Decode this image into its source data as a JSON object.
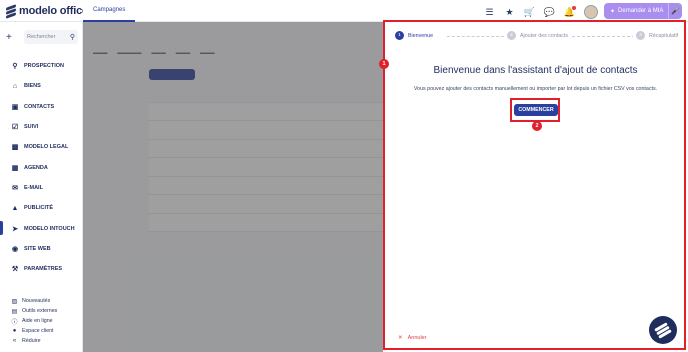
{
  "app": {
    "logo_text": "modelo office",
    "active_tab": "Campagnes"
  },
  "header": {
    "icons": [
      "layers-icon",
      "star-icon",
      "cart-icon",
      "chat-icon",
      "bell-icon"
    ],
    "mia_label": "Demander à MIA"
  },
  "sidebar": {
    "search_placeholder": "Rechercher",
    "items": [
      {
        "label": "PROSPECTION",
        "icon": "search-icon"
      },
      {
        "label": "BIENS",
        "icon": "home-icon"
      },
      {
        "label": "CONTACTS",
        "icon": "contacts-icon"
      },
      {
        "label": "SUIVI",
        "icon": "calendar-check-icon"
      },
      {
        "label": "MODELO LEGAL",
        "icon": "folder-icon"
      },
      {
        "label": "AGENDA",
        "icon": "calendar-icon"
      },
      {
        "label": "E-MAIL",
        "icon": "mail-icon"
      },
      {
        "label": "PUBLICITÉ",
        "icon": "megaphone-icon"
      },
      {
        "label": "MODELO INTOUCH",
        "icon": "send-icon"
      },
      {
        "label": "SITE WEB",
        "icon": "globe-icon"
      },
      {
        "label": "PARAMÈTRES",
        "icon": "wrench-icon"
      }
    ],
    "active_index": 8,
    "bottom_links": [
      {
        "label": "Nouveautés",
        "icon": "gift-icon"
      },
      {
        "label": "Outils externes",
        "icon": "briefcase-icon"
      },
      {
        "label": "Aide en ligne",
        "icon": "info-icon"
      },
      {
        "label": "Espace client",
        "icon": "user-icon"
      },
      {
        "label": "Réduire",
        "icon": "collapse-icon"
      }
    ]
  },
  "wizard": {
    "steps": [
      {
        "num": "1",
        "label": "Bienvenue"
      },
      {
        "num": "2",
        "label": "Ajouter des contacts"
      },
      {
        "num": "3",
        "label": "Récapitulatif"
      }
    ],
    "active_step": 0,
    "title": "Bienvenue dans l'assistant d'ajout de contacts",
    "description": "Vous pouvez ajouter des contacts manuellement ou importer par lot depuis un fichier CSV vos contacts.",
    "start_label": "COMMENCER",
    "cancel_label": "Annuler"
  },
  "annotations": {
    "badge_1": "1",
    "badge_2": "2",
    "color": "#e0202c"
  }
}
